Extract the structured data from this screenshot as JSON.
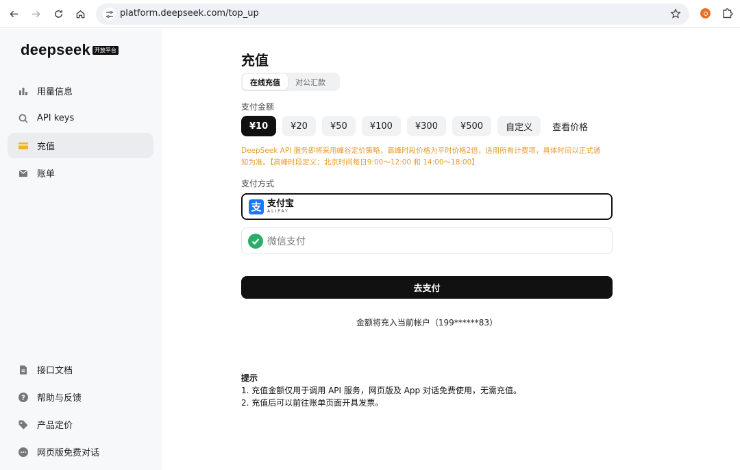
{
  "browser": {
    "url": "platform.deepseek.com/top_up"
  },
  "sidebar": {
    "logo": "deepseek",
    "logo_badge": "开放平台",
    "items": [
      {
        "label": "用量信息"
      },
      {
        "label": "API keys"
      },
      {
        "label": "充值"
      },
      {
        "label": "账单"
      }
    ],
    "bottom_items": [
      {
        "label": "接口文档"
      },
      {
        "label": "帮助与反馈"
      },
      {
        "label": "产品定价"
      },
      {
        "label": "网页版免费对话"
      }
    ]
  },
  "main": {
    "title": "充值",
    "tabs": [
      {
        "label": "在线充值"
      },
      {
        "label": "对公汇款"
      }
    ],
    "amount_label": "支付金额",
    "amounts": [
      {
        "label": "¥10"
      },
      {
        "label": "¥20"
      },
      {
        "label": "¥50"
      },
      {
        "label": "¥100"
      },
      {
        "label": "¥300"
      },
      {
        "label": "¥500"
      },
      {
        "label": "自定义"
      },
      {
        "label": "查看价格"
      }
    ],
    "notice_line1": "DeepSeek API 服务即将采用峰谷定价策略，高峰时段价格为平时价格2倍，适用所有计费项，具体时间以正式通",
    "notice_line2": "知为准。【高峰时段定义：北京时间每日9:00～12:00 和 14:00～18:00】",
    "method_label": "支付方式",
    "alipay_cn": "支付宝",
    "alipay_en": "ALIPAY",
    "alipay_glyph": "支",
    "wechat": "微信支付",
    "pay_button": "去支付",
    "account_note": "金额将充入当前帐户（199******83）",
    "tips_title": "提示",
    "tips": [
      "1. 充值金额仅用于调用 API 服务，网页版及 App 对话免费使用，无需充值。",
      "2. 充值后可以前往账单页面开具发票。"
    ]
  },
  "colors": {
    "accent": "#111111",
    "notice": "#e89a2c",
    "alipay": "#1677ff",
    "wechat": "#2aae67"
  }
}
